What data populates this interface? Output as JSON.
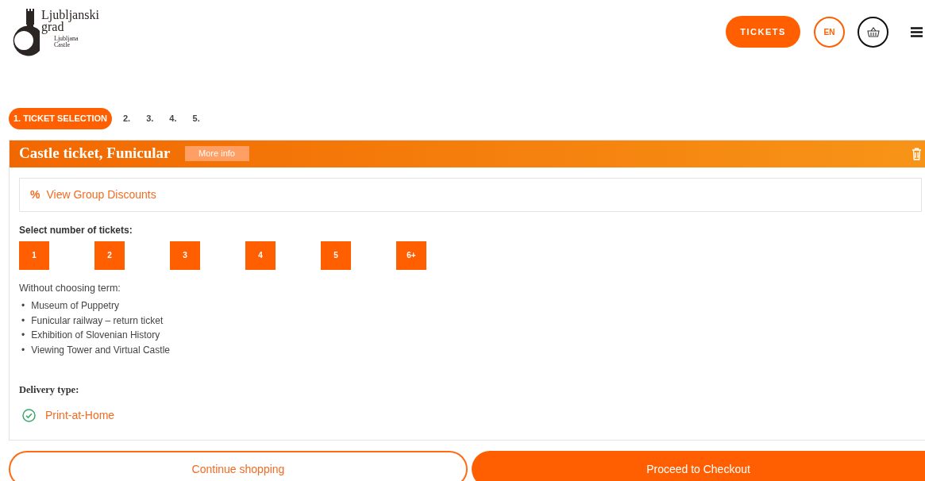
{
  "logo": {
    "name": "Ljubljanski grad",
    "subtitle": "Ljubljana Castle"
  },
  "header": {
    "tickets_button": "TICKETS",
    "language": "EN"
  },
  "steps": [
    {
      "label": "1. TICKET SELECTION",
      "selected": true
    },
    {
      "label": "2.",
      "selected": false
    },
    {
      "label": "3.",
      "selected": false
    },
    {
      "label": "4.",
      "selected": false
    },
    {
      "label": "5.",
      "selected": false
    }
  ],
  "product": {
    "title": "Castle ticket, Funicular",
    "more_info": "More info",
    "group_discounts": {
      "icon": "%",
      "label": "View Group Discounts"
    },
    "quantity_label": "Select number of tickets:",
    "quantities": [
      "1",
      "2",
      "3",
      "4",
      "5",
      "6+"
    ],
    "term_note": "Without choosing term:",
    "includes": [
      {
        "marker": "•",
        "text": "Museum of Puppetry"
      },
      {
        "marker": "•",
        "text": "Funicular railway – return ticket"
      },
      {
        "marker": "•",
        "text": "Exhibition of Slovenian History"
      },
      {
        "marker": "•",
        "text": "Viewing Tower and Virtual Castle"
      }
    ],
    "delivery_label": "Delivery type:",
    "delivery_options": [
      {
        "label": "Print-at-Home",
        "selected": true
      }
    ]
  },
  "actions": {
    "continue": "Continue shopping",
    "checkout": "Proceed to Checkout"
  }
}
